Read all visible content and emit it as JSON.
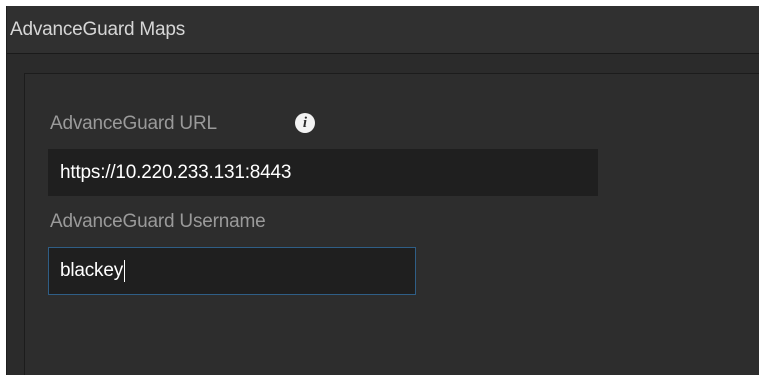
{
  "header": {
    "title": "AdvanceGuard Maps"
  },
  "form": {
    "url_label": "AdvanceGuard URL",
    "url_value": "https://10.220.233.131:8443",
    "username_label": "AdvanceGuard Username",
    "username_value": "blackey"
  },
  "icons": {
    "info": "info-icon"
  },
  "colors": {
    "background": "#2b2b2b",
    "input_background": "#1f1f1f",
    "focus_border": "#2f5e86",
    "label_text": "#9a9a9a"
  }
}
